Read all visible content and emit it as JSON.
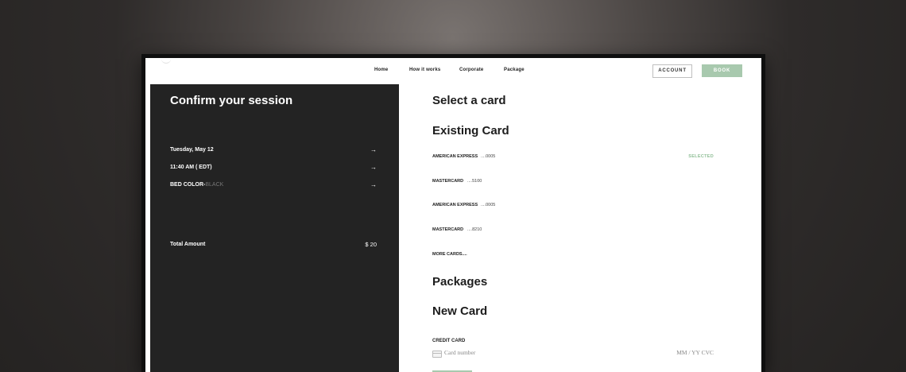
{
  "nav": {
    "home": "Home",
    "how_it_works": "How it works",
    "corporate": "Corporate",
    "package": "Package",
    "account": "ACCOUNT",
    "book": "BOOK"
  },
  "confirm": {
    "title": "Confirm your session",
    "rows": [
      {
        "label": "Tuesday, May 12",
        "arrow": "→"
      },
      {
        "label": "11:40 AM ( EDT)",
        "arrow": "→"
      },
      {
        "label": "BED COLOR-",
        "label_muted": "BLACK",
        "arrow": "→"
      }
    ],
    "total_label": "Total Amount",
    "total_currency": "$",
    "total_value": "20"
  },
  "payment": {
    "select_title": "Select a card",
    "existing_title": "Existing Card",
    "cards": [
      {
        "brand": "AMERICAN EXPRESS",
        "digits": "....0005",
        "status": "SELECTED"
      },
      {
        "brand": "MASTERCARD",
        "digits": "....5100",
        "status": ""
      },
      {
        "brand": "AMERICAN EXPRESS",
        "digits": "....0005",
        "status": ""
      },
      {
        "brand": "MASTERCARD",
        "digits": "....8210",
        "status": ""
      }
    ],
    "more_cards": "MORE CARDS....",
    "packages_title": "Packages",
    "new_card_title": "New Card",
    "credit_card_label": "CREDIT CARD",
    "card_number_placeholder": "Card number",
    "card_exp_cvc_placeholder": "MM / YY  CVC"
  },
  "colors": {
    "accent_green": "#a8c9ae",
    "selected_green": "#8fbf96",
    "left_panel": "#232323"
  }
}
